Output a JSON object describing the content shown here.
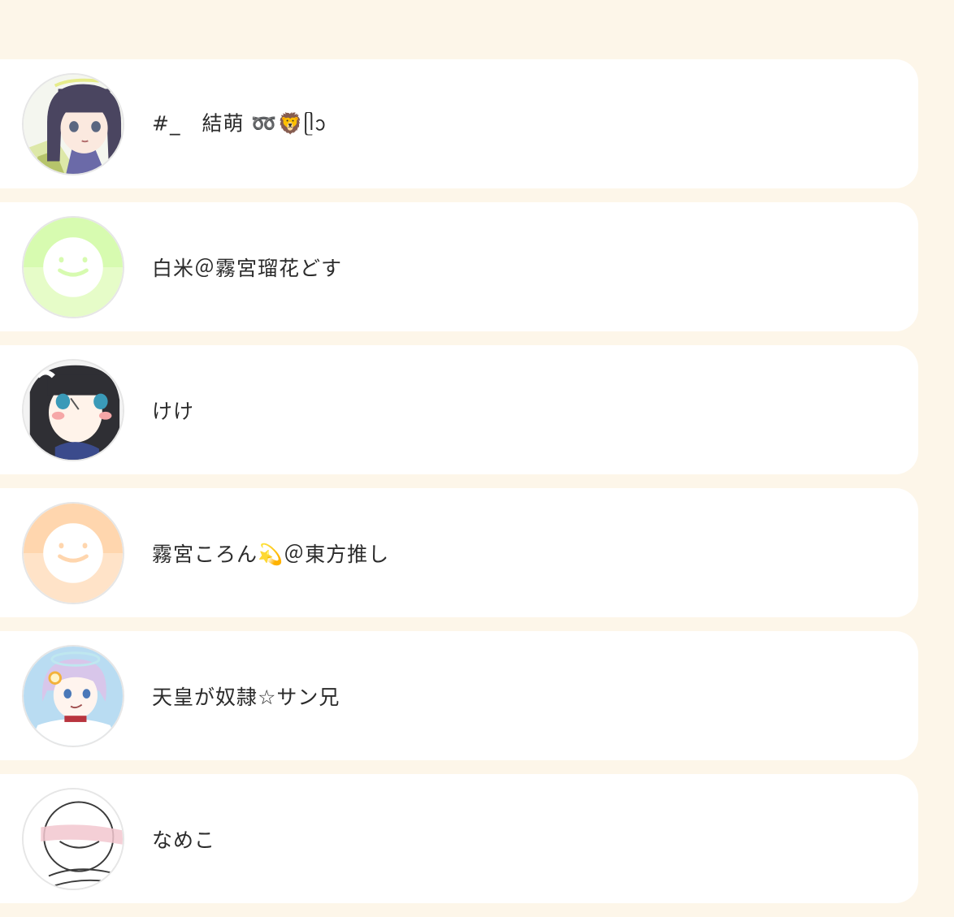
{
  "users": [
    {
      "name": "#_　結萌 ➿🦁ᥫᩣ",
      "avatar": "anime-girl-dark-hair-avatar"
    },
    {
      "name": "白米＠霧宮瑠花どす",
      "avatar": "default-smiley-avatar",
      "color": "#d7fbb0"
    },
    {
      "name": "けけ",
      "avatar": "anime-girl-black-hair-avatar"
    },
    {
      "name": "霧宮ころん💫＠東方推し",
      "avatar": "default-smiley-avatar",
      "color": "#ffd6ae"
    },
    {
      "name": "天皇が奴隷☆サン兄",
      "avatar": "anime-boy-lavender-hair-avatar"
    },
    {
      "name": "なめこ",
      "avatar": "sketch-face-avatar"
    }
  ],
  "colors": {
    "background": "#fdf6e9",
    "card": "#ffffff",
    "text": "#2b2b2b"
  }
}
